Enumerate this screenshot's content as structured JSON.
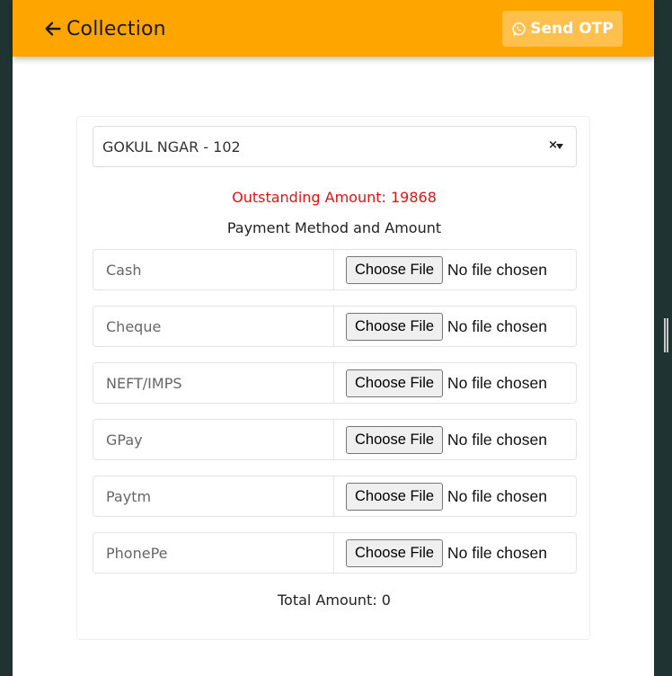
{
  "header": {
    "title": "Collection",
    "otp_label": "Send OTP",
    "background": "#ffa500"
  },
  "form": {
    "selected_property": "GOKUL NGAR - 102",
    "outstanding": "Outstanding Amount: 19868",
    "payment_heading": "Payment Method and Amount",
    "methods": [
      {
        "placeholder": "Cash",
        "button": "Choose File",
        "file_status": "No file chosen"
      },
      {
        "placeholder": "Cheque",
        "button": "Choose File",
        "file_status": "No file chosen"
      },
      {
        "placeholder": "NEFT/IMPS",
        "button": "Choose File",
        "file_status": "No file chosen"
      },
      {
        "placeholder": "GPay",
        "button": "Choose File",
        "file_status": "No file chosen"
      },
      {
        "placeholder": "Paytm",
        "button": "Choose File",
        "file_status": "No file chosen"
      },
      {
        "placeholder": "PhonePe",
        "button": "Choose File",
        "file_status": "No file chosen"
      }
    ],
    "total": "Total Amount: 0"
  },
  "icons": {
    "back": "arrow-left-icon",
    "otp": "whatsapp-icon",
    "clear": "clear-x-icon",
    "dropdown": "chevron-down-icon"
  },
  "colors": {
    "accent": "#ffa500",
    "otp_button": "#ffc04d",
    "outstanding_text": "#e81010"
  }
}
